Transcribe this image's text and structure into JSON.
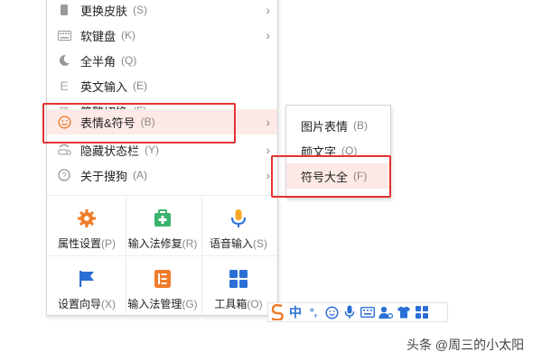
{
  "menu": {
    "items": [
      {
        "label": "更换皮肤",
        "hotkey": "(S)",
        "icon": "skin-icon",
        "arrow": true
      },
      {
        "label": "软键盘",
        "hotkey": "(K)",
        "icon": "keyboard-icon",
        "arrow": true
      },
      {
        "label": "全半角",
        "hotkey": "(Q)",
        "icon": "moon-icon",
        "arrow": false
      },
      {
        "label": "英文输入",
        "hotkey": "(E)",
        "icon": "english-e-icon",
        "arrow": false
      },
      {
        "label": "简繁切换",
        "hotkey": "(F)",
        "icon": "traditional-icon",
        "arrow": true
      },
      {
        "label": "表情&符号",
        "hotkey": "(B)",
        "icon": "smiley-icon",
        "arrow": true
      },
      {
        "label": "隐藏状态栏",
        "hotkey": "(Y)",
        "icon": "hide-status-icon",
        "arrow": true
      },
      {
        "label": "关于搜狗",
        "hotkey": "(A)",
        "icon": "help-icon",
        "arrow": true
      }
    ],
    "tiles": [
      {
        "label": "属性设置",
        "hotkey": "(P)",
        "icon": "gear-icon"
      },
      {
        "label": "输入法修复",
        "hotkey": "(R)",
        "icon": "repair-kit-icon"
      },
      {
        "label": "语音输入",
        "hotkey": "(S)",
        "icon": "microphone-icon"
      },
      {
        "label": "设置向导",
        "hotkey": "(X)",
        "icon": "flag-icon"
      },
      {
        "label": "输入法管理",
        "hotkey": "(G)",
        "icon": "manage-list-icon"
      },
      {
        "label": "工具箱",
        "hotkey": "(O)",
        "icon": "toolbox-grid-icon"
      }
    ]
  },
  "submenu": {
    "items": [
      {
        "label": "图片表情",
        "hotkey": "(B)"
      },
      {
        "label": "颜文字",
        "hotkey": "(Q)"
      },
      {
        "label": "符号大全",
        "hotkey": "(F)"
      }
    ]
  },
  "toolbar": {
    "lang": "中",
    "punct": "°,",
    "icons": [
      "sogou-logo-icon",
      "smiley-icon",
      "microphone-icon",
      "keyboard-icon",
      "user-settings-icon",
      "skin-shirt-icon",
      "toolbox-grid-icon"
    ]
  },
  "watermark": "头条 @周三的小太阳",
  "colors": {
    "highlight": "#fde9e6",
    "red_box": "#e53232",
    "orange": "#f07c2b",
    "green": "#3bb36c",
    "blue": "#2b6fd6"
  }
}
